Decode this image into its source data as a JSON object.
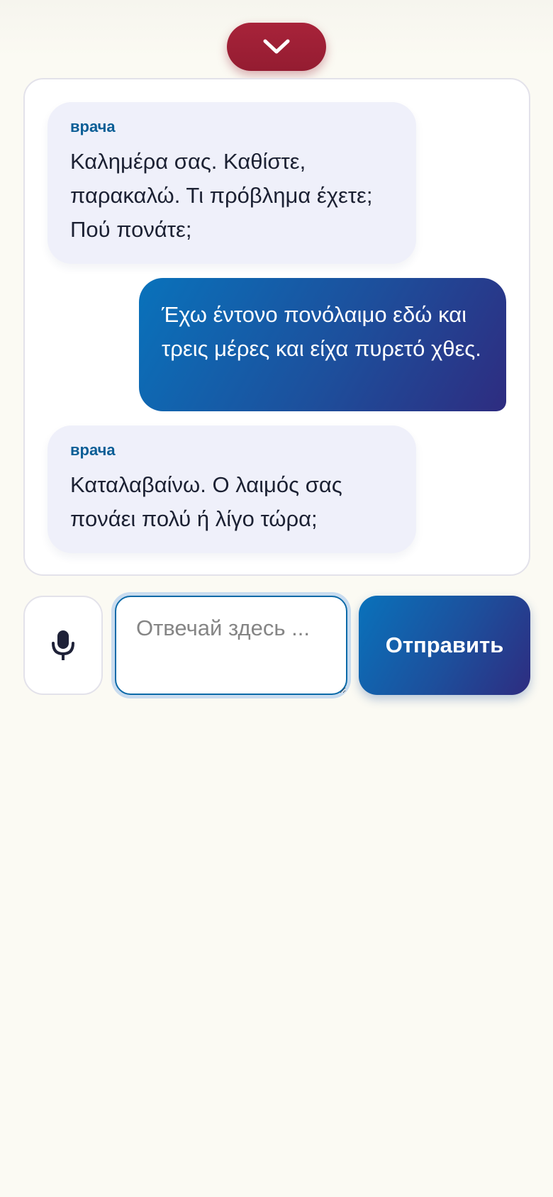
{
  "controls": {
    "collapse_icon": "chevron-down-icon",
    "mic_icon": "microphone-icon"
  },
  "chat": {
    "messages": [
      {
        "role": "incoming",
        "sender": "врача",
        "text": "Καλημέρα σας. Καθίστε, παρακαλώ. Τι πρόβλημα έχετε; Πού πονάτε;"
      },
      {
        "role": "outgoing",
        "text": "Έχω έντονο πονόλαιμο εδώ και τρεις μέρες και είχα πυρετό χθες."
      },
      {
        "role": "incoming",
        "sender": "врача",
        "text": "Καταλαβαίνω. Ο λαιμός σας πονάει πολύ ή λίγο τώρα;"
      }
    ]
  },
  "composer": {
    "placeholder": "Отвечай здесь ...",
    "value": "",
    "send_label": "Отправить"
  },
  "colors": {
    "accent_red": "#a8233a",
    "accent_blue": "#0972bb",
    "accent_indigo": "#2e2c80",
    "incoming_bubble": "#eff0fa",
    "sender_label": "#0b5e96",
    "background": "#fbfaf3"
  }
}
